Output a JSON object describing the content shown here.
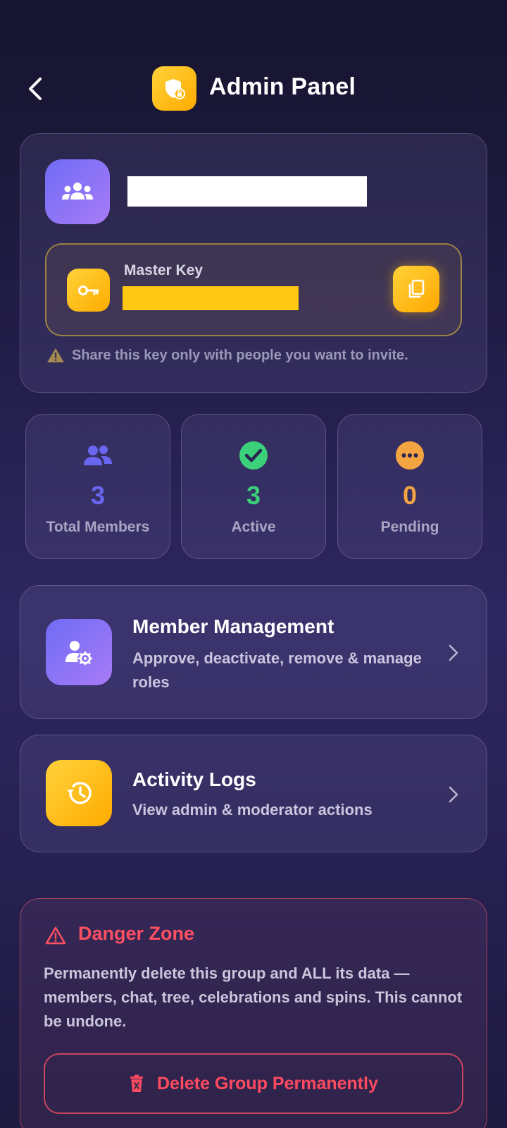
{
  "header": {
    "title": "Admin Panel",
    "back_icon": "chevron-left-icon",
    "logo_icon": "shield-lock-icon"
  },
  "group": {
    "icon": "group-icon"
  },
  "master_key": {
    "label": "Master Key",
    "key_icon": "key-icon",
    "copy_icon": "copy-icon"
  },
  "warning": {
    "text": "Share this key only with people you want to invite."
  },
  "stats": [
    {
      "value": "3",
      "label": "Total Members",
      "color": "#6b66f0",
      "icon": "users-icon"
    },
    {
      "value": "3",
      "label": "Active",
      "color": "#3bd17b",
      "icon": "check-circle-icon"
    },
    {
      "value": "0",
      "label": "Pending",
      "color": "#f5a442",
      "icon": "more-circle-icon"
    }
  ],
  "menu": [
    {
      "title": "Member Management",
      "subtitle": "Approve, deactivate, remove & manage roles",
      "icon": "user-settings-icon"
    },
    {
      "title": "Activity Logs",
      "subtitle": "View admin & moderator actions",
      "icon": "history-icon"
    }
  ],
  "danger": {
    "title": "Danger Zone",
    "text": "Permanently delete this group and ALL its data — members, chat, tree, celebrations and spins. This cannot be undone.",
    "button": "Delete Group Permanently",
    "color": "#ff4f63"
  }
}
